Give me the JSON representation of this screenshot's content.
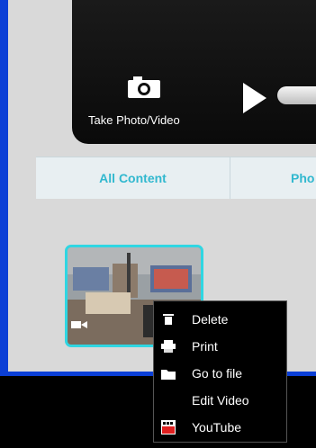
{
  "camera": {
    "take_label": "Take Photo/Video"
  },
  "tabs": [
    {
      "label": "All Content"
    },
    {
      "label": "Pho"
    }
  ],
  "context_menu": {
    "items": [
      {
        "label": "Delete",
        "icon": "trash-icon"
      },
      {
        "label": "Print",
        "icon": "printer-icon"
      },
      {
        "label": "Go to file",
        "icon": "folder-icon"
      },
      {
        "label": "Edit Video",
        "icon": ""
      },
      {
        "label": "YouTube",
        "icon": "youtube-icon"
      }
    ]
  },
  "colors": {
    "accent": "#31b8cf",
    "thumb_border": "#2fd6e2",
    "window_frame": "#0b3fd6"
  }
}
